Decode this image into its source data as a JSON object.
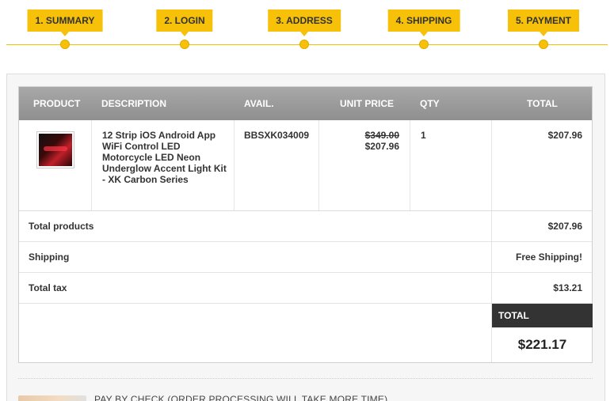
{
  "steps": [
    {
      "label": "1. SUMMARY"
    },
    {
      "label": "2. LOGIN"
    },
    {
      "label": "3. ADDRESS"
    },
    {
      "label": "4. SHIPPING"
    },
    {
      "label": "5. PAYMENT"
    }
  ],
  "cart": {
    "headers": {
      "product": "PRODUCT",
      "description": "DESCRIPTION",
      "avail": "AVAIL.",
      "unit_price": "UNIT PRICE",
      "qty": "QTY",
      "total": "TOTAL"
    },
    "item": {
      "description": "12 Strip iOS Android App WiFi Control LED Motorcycle LED Neon Underglow Accent Light Kit - XK Carbon Series",
      "avail": "BBSXK034009",
      "old_price": "$349.00",
      "unit_price": "$207.96",
      "qty": "1",
      "total": "$207.96"
    },
    "summary": {
      "total_products_label": "Total products",
      "total_products_value": "$207.96",
      "shipping_label": "Shipping",
      "shipping_value": "Free Shipping!",
      "tax_label": "Total tax",
      "tax_value": "$13.21",
      "total_label": "TOTAL",
      "grand_total": "$221.17"
    }
  },
  "payment": {
    "check_label": "PAY BY CHECK (ORDER PROCESSING WILL TAKE MORE TIME)"
  },
  "colors": {
    "accent": "#f6c108",
    "header_gray": "#9a9a9a",
    "total_dark": "#333333"
  }
}
